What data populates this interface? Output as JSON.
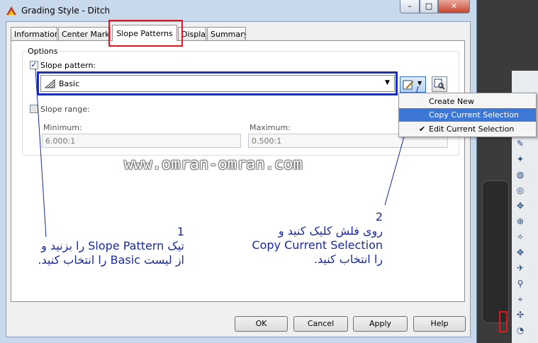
{
  "window": {
    "title": "Grading Style - Ditch",
    "minimize": "–",
    "maximize": "□",
    "close": "✕"
  },
  "tabs": [
    {
      "label": "Information"
    },
    {
      "label": "Center Marker"
    },
    {
      "label": "Slope Patterns"
    },
    {
      "label": "Display"
    },
    {
      "label": "Summary"
    }
  ],
  "options": {
    "group_label": "Options",
    "slope_pattern_label": "Slope pattern:",
    "slope_pattern_checked": "✓",
    "pattern_value": "Basic",
    "slope_range_label": "Slope range:",
    "minimum_label": "Minimum:",
    "maximum_label": "Maximum:",
    "minimum_value": "6.000:1",
    "maximum_value": "0.500:1"
  },
  "menu": {
    "items": [
      {
        "label": "Create New"
      },
      {
        "label": "Copy Current Selection"
      },
      {
        "label": "Edit Current Selection"
      }
    ],
    "checkmark": "✔"
  },
  "watermark": "www.omran-omran.com",
  "annotations": {
    "a1": {
      "number": "1",
      "line1": "تیک Slope Pattern را بزنید و",
      "line2": "از لیست Basic را انتخاب کنید."
    },
    "a2": {
      "number": "2",
      "line1": "روی فلش کلیک کنید و",
      "line2": "Copy Current Selection",
      "line3": "را انتخاب کنید."
    }
  },
  "buttons": {
    "ok": "OK",
    "cancel": "Cancel",
    "apply": "Apply",
    "help": "Help"
  },
  "colors": {
    "highlight_red": "#e8141b",
    "highlight_blue": "#1d2fb8",
    "annotation_text": "#1a2a9e",
    "menu_selected": "#3e78d6"
  }
}
